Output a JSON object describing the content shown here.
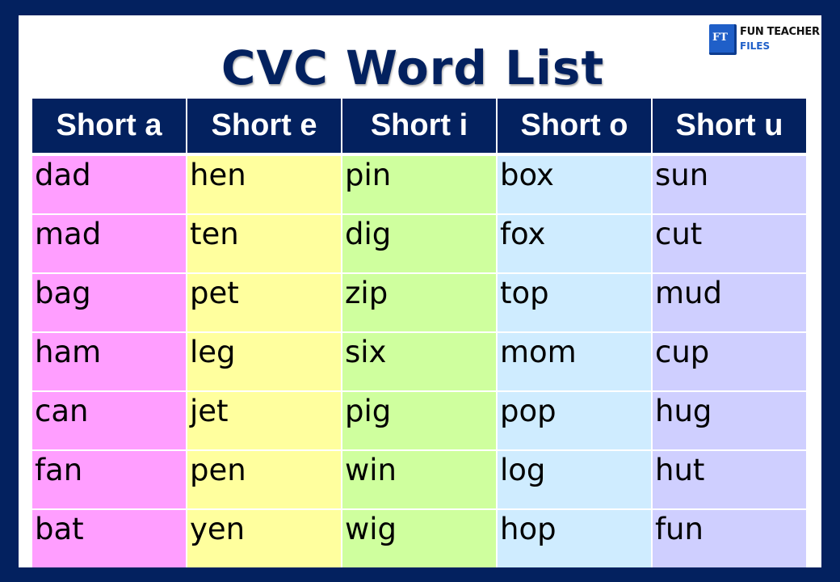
{
  "title": "CVC Word List",
  "logo": {
    "icon": "book-icon",
    "mark": "FT",
    "line1": "FUN TEACHER",
    "line2": "FILES"
  },
  "table": {
    "headers": [
      "Short a",
      "Short e",
      "Short i",
      "Short o",
      "Short u"
    ],
    "column_colors": [
      "#ff9eff",
      "#ffff9e",
      "#cfff9e",
      "#cfecff",
      "#cfcfff"
    ],
    "rows": [
      [
        "dad",
        "hen",
        "pin",
        "box",
        "sun"
      ],
      [
        "mad",
        "ten",
        "dig",
        "fox",
        "cut"
      ],
      [
        "bag",
        "pet",
        "zip",
        "top",
        "mud"
      ],
      [
        "ham",
        "leg",
        "six",
        "mom",
        "cup"
      ],
      [
        "can",
        "jet",
        "pig",
        "pop",
        "hug"
      ],
      [
        "fan",
        "pen",
        "win",
        "log",
        "hut"
      ],
      [
        "bat",
        "yen",
        "wig",
        "hop",
        "fun"
      ]
    ]
  }
}
